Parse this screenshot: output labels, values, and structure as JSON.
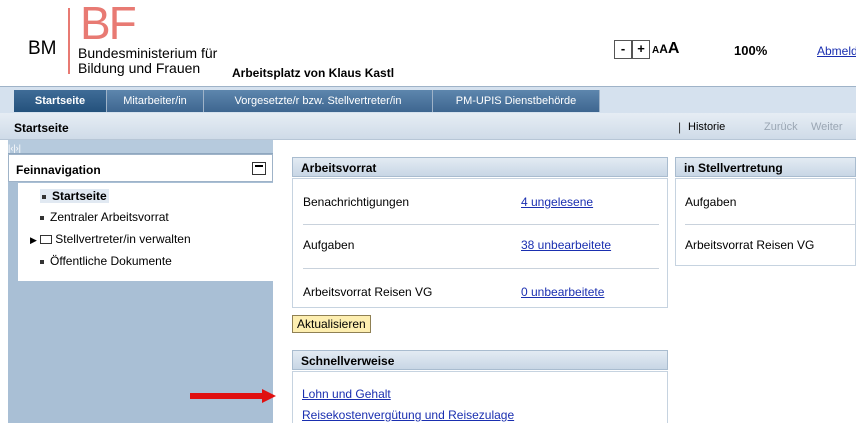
{
  "header": {
    "logo_bm": "BM",
    "logo_bf": "BF",
    "ministry_line1": "Bundesministerium für",
    "ministry_line2": "Bildung und Frauen",
    "workplace": "Arbeitsplatz von Klaus Kastl",
    "decrease_label": "-",
    "increase_label": "+",
    "font_size_label": "AAA",
    "zoom": "100%",
    "logout": "Abmelden"
  },
  "tabs": [
    {
      "label": "Startseite"
    },
    {
      "label": "Mitarbeiter/in"
    },
    {
      "label": "Vorgesetzte/r bzw. Stellvertreter/in"
    },
    {
      "label": "PM-UPIS Dienstbehörde"
    }
  ],
  "subbar": {
    "title": "Startseite",
    "separator": "|",
    "history": "Historie",
    "back": "Zurück",
    "forward": "Weiter"
  },
  "nav": {
    "toggles": "|‹|›|",
    "title": "Feinnavigation",
    "items": [
      {
        "label": "Startseite"
      },
      {
        "label": "Zentraler Arbeitsvorrat"
      },
      {
        "label": "Stellvertreter/in verwalten"
      },
      {
        "label": "Öffentliche Dokumente"
      }
    ]
  },
  "worklist": {
    "title": "Arbeitsvorrat",
    "rows": [
      {
        "label": "Benachrichtigungen",
        "link": "4 ungelesene"
      },
      {
        "label": "Aufgaben",
        "link": "38 unbearbeitete"
      },
      {
        "label": "Arbeitsvorrat Reisen VG",
        "link": "0 unbearbeitete"
      }
    ],
    "refresh": "Aktualisieren"
  },
  "deputy": {
    "title": "in Stellvertretung",
    "rows": [
      {
        "label": "Aufgaben"
      },
      {
        "label": "Arbeitsvorrat Reisen VG"
      }
    ]
  },
  "quicklinks": {
    "title": "Schnellverweise",
    "links": [
      {
        "label": "Lohn und Gehalt"
      },
      {
        "label": "Reisekostenvergütung und Reisezulage"
      }
    ]
  },
  "colors": {
    "link": "#1a2fb0",
    "brand": "#e87a73",
    "arrow": "#e01010"
  }
}
